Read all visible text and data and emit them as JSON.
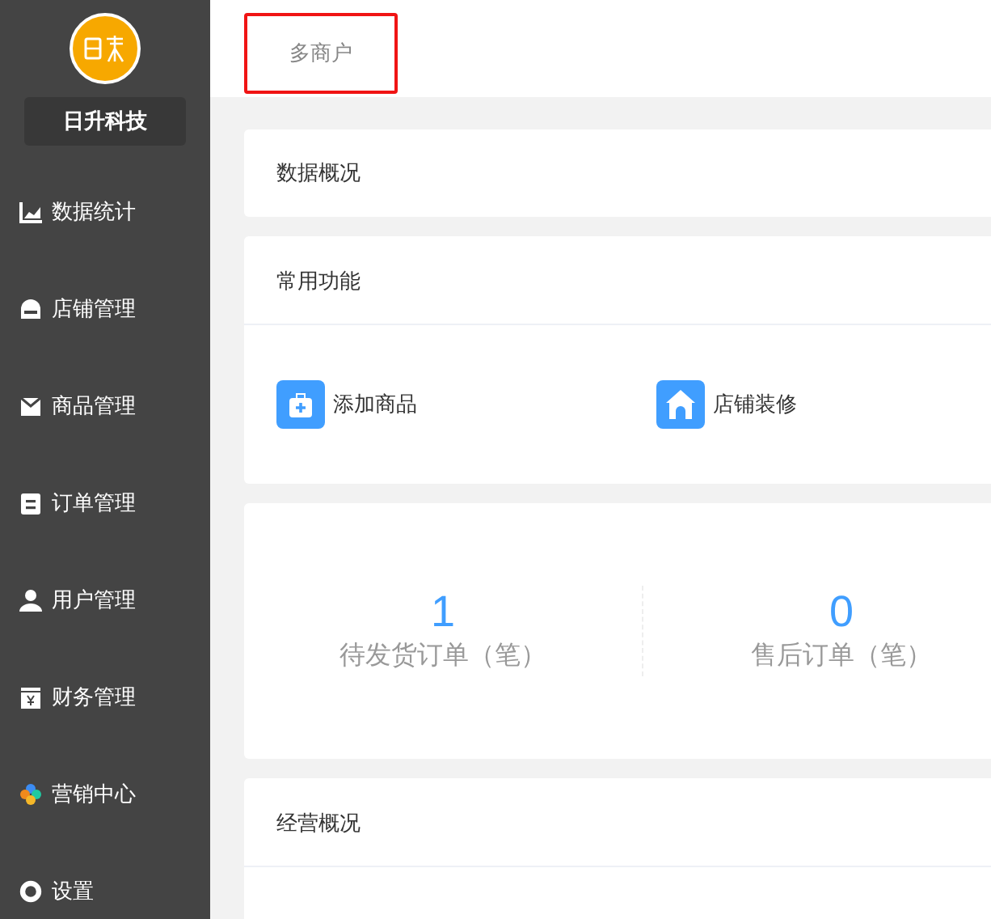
{
  "brand": {
    "name": "日升科技"
  },
  "menu": [
    {
      "label": "数据统计"
    },
    {
      "label": "店铺管理"
    },
    {
      "label": "商品管理"
    },
    {
      "label": "订单管理"
    },
    {
      "label": "用户管理"
    },
    {
      "label": "财务管理"
    },
    {
      "label": "营销中心"
    },
    {
      "label": "设置"
    }
  ],
  "tabs": [
    {
      "label": "多商户"
    }
  ],
  "sections": [
    {
      "kind": "header",
      "title": "数据概况"
    },
    {
      "kind": "shortcuts",
      "title": "常用功能",
      "items": [
        {
          "label": "添加商品"
        },
        {
          "label": "店铺装修"
        }
      ]
    },
    {
      "kind": "stats",
      "items": [
        {
          "value": "1",
          "label": "待发货订单（笔）"
        },
        {
          "value": "0",
          "label": "售后订单（笔）"
        }
      ]
    },
    {
      "kind": "open",
      "title": "经营概况"
    }
  ]
}
